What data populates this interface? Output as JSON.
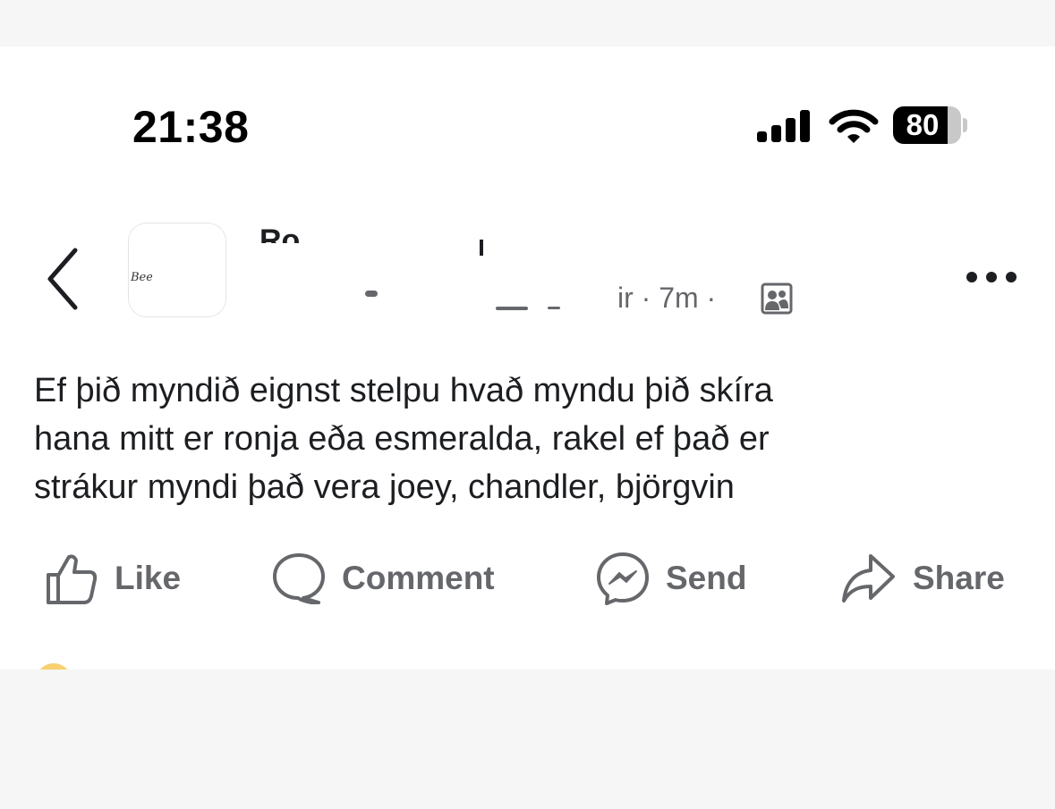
{
  "status_bar": {
    "time": "21:38",
    "battery_percent": "80",
    "battery_level": 0.8,
    "signal_bars": 4,
    "icons": [
      "signal-icon",
      "wifi-icon",
      "battery-icon"
    ]
  },
  "header": {
    "back_icon": "chevron-left-icon",
    "avatar_text": "Bee",
    "name_visible_fragment": "Ro",
    "meta_fragment": "ir",
    "time_ago": "7m",
    "separator": "·",
    "audience_icon": "group-icon",
    "more_icon": "more-horizontal-icon"
  },
  "post": {
    "text_lines": [
      "Ef þið myndið eignst stelpu hvað myndu þið skíra",
      "hana mitt er ronja eða esmeralda, rakel ef það er",
      "strákur myndi það vera joey, chandler, björgvin"
    ]
  },
  "actions": {
    "like": "Like",
    "comment": "Comment",
    "send": "Send",
    "share": "Share"
  },
  "colors": {
    "text_primary": "#1c1e21",
    "text_secondary": "#65676b",
    "background": "#f6f6f6",
    "card": "#ffffff"
  }
}
